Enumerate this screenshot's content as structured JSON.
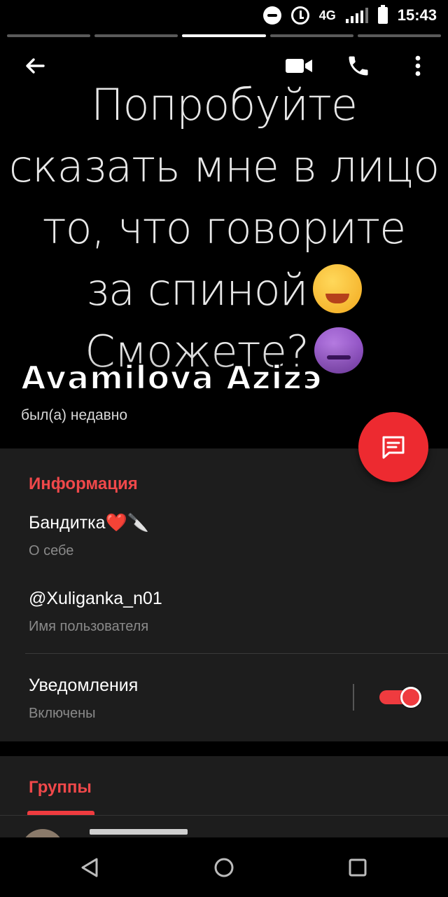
{
  "status_bar": {
    "network": "4G",
    "time": "15:43",
    "icons": [
      "do-not-disturb-icon",
      "alarm-icon",
      "signal-icon",
      "battery-icon"
    ]
  },
  "story": {
    "segments": 5,
    "active_segment": 3
  },
  "topbar": {
    "icons": [
      "back-arrow-icon",
      "video-call-icon",
      "phone-icon",
      "more-vert-icon"
    ]
  },
  "hero": {
    "quote_lines": [
      "Попробуйте",
      "сказать мне в лицо",
      "то, что говорите",
      "за спиной",
      "Сможете?"
    ],
    "name": "Avamilova Azizэ",
    "last_seen": "был(а) недавно"
  },
  "fab": {
    "icon": "message-icon",
    "color": "#ed2a30"
  },
  "info": {
    "title": "Информация",
    "bio": {
      "value": "Бандитка❤️🔪",
      "caption": "О себе"
    },
    "username": {
      "value": "@Xuliganka_n01",
      "caption": "Имя пользователя"
    },
    "notifications": {
      "value": "Уведомления",
      "caption": "Включены",
      "enabled": true
    }
  },
  "groups": {
    "title": "Группы"
  },
  "colors": {
    "accent": "#ef3b3f",
    "card_bg": "#1d1d1d",
    "caption": "#8a8a8a"
  },
  "navbar": {
    "icons": [
      "nav-back-icon",
      "nav-home-icon",
      "nav-recents-icon"
    ]
  }
}
